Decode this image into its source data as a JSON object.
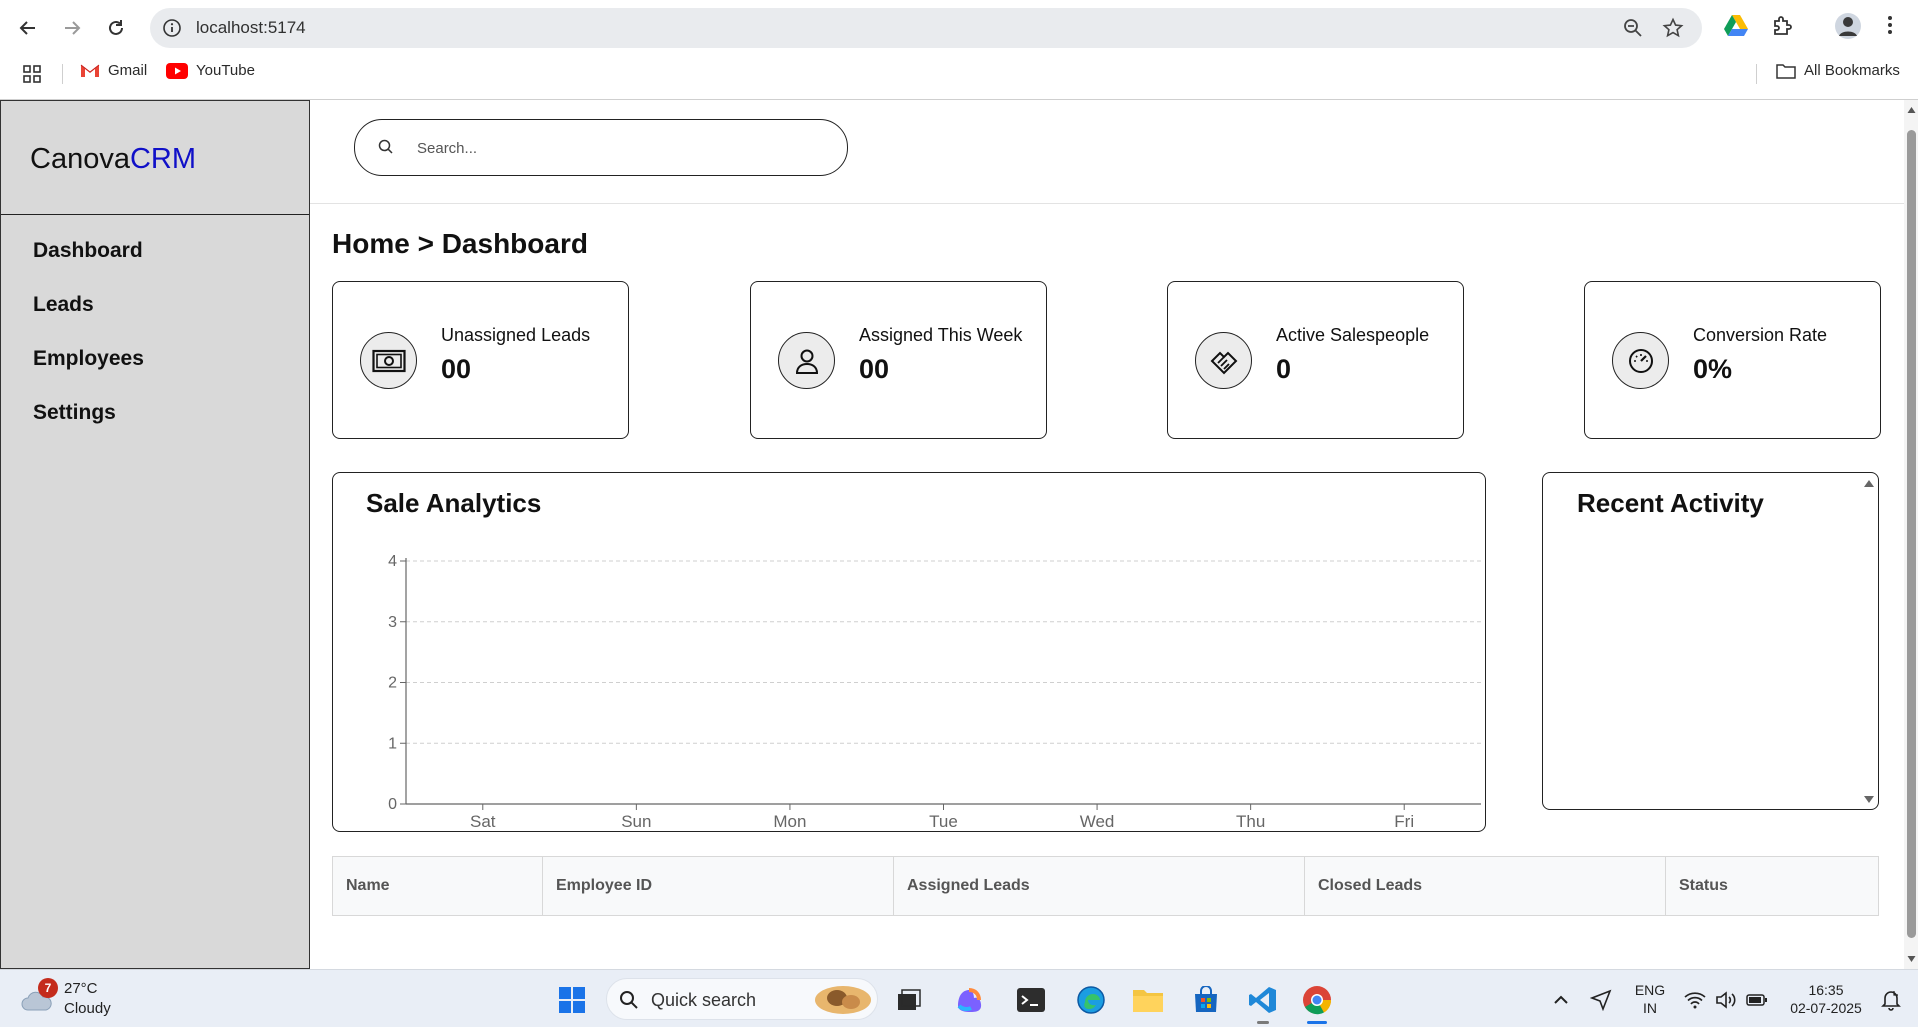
{
  "browser": {
    "url": "localhost:5174",
    "bookmarks": [
      {
        "label": "Gmail",
        "icon": "gmail-icon"
      },
      {
        "label": "YouTube",
        "icon": "youtube-icon"
      }
    ],
    "all_bookmarks": "All Bookmarks"
  },
  "sidebar": {
    "brand_prefix": "Canova",
    "brand_suffix": "CRM",
    "brand_accent_color": "#1010c8",
    "items": [
      {
        "label": "Dashboard"
      },
      {
        "label": "Leads"
      },
      {
        "label": "Employees"
      },
      {
        "label": "Settings"
      }
    ]
  },
  "search": {
    "placeholder": "Search..."
  },
  "breadcrumb": "Home > Dashboard",
  "cards": [
    {
      "label": "Unassigned Leads",
      "value": "00",
      "icon": "banknote-icon"
    },
    {
      "label": "Assigned This Week",
      "value": "00",
      "icon": "user-icon"
    },
    {
      "label": "Active Salespeople",
      "value": "0",
      "icon": "handshake-icon"
    },
    {
      "label": "Conversion Rate",
      "value": "0%",
      "icon": "speedometer-icon"
    }
  ],
  "analytics": {
    "title": "Sale Analytics"
  },
  "chart_data": {
    "type": "bar",
    "title": "Sale Analytics",
    "categories": [
      "Sat",
      "Sun",
      "Mon",
      "Tue",
      "Wed",
      "Thu",
      "Fri"
    ],
    "values": [
      0,
      0,
      0,
      0,
      0,
      0,
      0
    ],
    "yticks": [
      0,
      1,
      2,
      3,
      4
    ],
    "ylim": [
      0,
      4
    ],
    "grid": true,
    "xlabel": "",
    "ylabel": ""
  },
  "recent_activity": {
    "title": "Recent Activity",
    "items": []
  },
  "employee_table": {
    "columns": [
      "Name",
      "Employee ID",
      "Assigned Leads",
      "Closed Leads",
      "Status"
    ],
    "rows": []
  },
  "taskbar": {
    "weather_badge": "7",
    "temperature": "27°C",
    "condition": "Cloudy",
    "quick_search": "Quick search",
    "lang_top": "ENG",
    "lang_bottom": "IN",
    "time": "16:35",
    "date": "02-07-2025"
  }
}
